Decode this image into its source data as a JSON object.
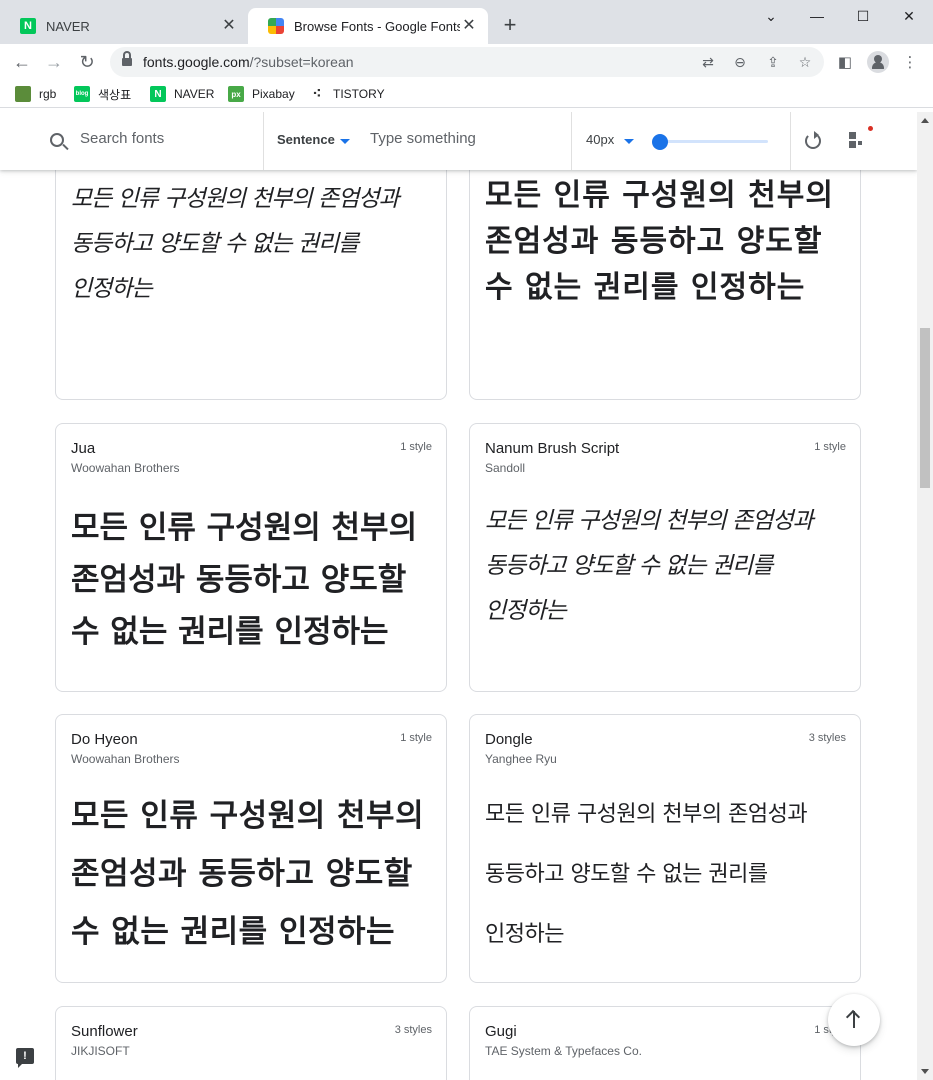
{
  "browser": {
    "tabs": [
      {
        "title": "NAVER",
        "favicon": "naver-icon",
        "active": false
      },
      {
        "title": "Browse Fonts - Google Fonts",
        "favicon": "google-fonts-icon",
        "active": true
      }
    ],
    "url_host": "fonts.google.com",
    "url_path": "/?subset=korean",
    "bookmarks": [
      {
        "label": "rgb",
        "icon": "image-icon",
        "color": "#5b8c3a"
      },
      {
        "label": "색상표",
        "icon": "blog-icon",
        "color": "#03c75a"
      },
      {
        "label": "NAVER",
        "icon": "naver-icon",
        "color": "#03c75a"
      },
      {
        "label": "Pixabay",
        "icon": "pixabay-icon",
        "color": "#48a947"
      },
      {
        "label": "TISTORY",
        "icon": "tistory-icon",
        "color": "#333333"
      }
    ]
  },
  "toolbar": {
    "search_placeholder": "Search fonts",
    "preview_mode": "Sentence",
    "type_placeholder": "Type something",
    "font_size": "40px",
    "font_size_fraction": 0.02,
    "accent_color": "#1a73e8"
  },
  "sample_text": "모든 인류 구성원의 천부의 존엄성과 동등하고 양도할 수 없는 권리를 인정하는",
  "cards": [
    {
      "name": "",
      "designer": "",
      "styles": "",
      "style_class": "s-brush",
      "partial": true
    },
    {
      "name": "",
      "designer": "",
      "styles": "",
      "style_class": "s-black",
      "partial": true
    },
    {
      "name": "Jua",
      "designer": "Woowahan Brothers",
      "styles": "1 style",
      "style_class": "s-jua"
    },
    {
      "name": "Nanum Brush Script",
      "designer": "Sandoll",
      "styles": "1 style",
      "style_class": "s-brush"
    },
    {
      "name": "Do Hyeon",
      "designer": "Woowahan Brothers",
      "styles": "1 style",
      "style_class": "s-dohyeon"
    },
    {
      "name": "Dongle",
      "designer": "Yanghee Ryu",
      "styles": "3 styles",
      "style_class": "s-dongle"
    },
    {
      "name": "Sunflower",
      "designer": "JIKJISOFT",
      "styles": "3 styles",
      "style_class": ""
    },
    {
      "name": "Gugi",
      "designer": "TAE System & Typefaces Co.",
      "styles": "1 style",
      "style_class": ""
    }
  ]
}
